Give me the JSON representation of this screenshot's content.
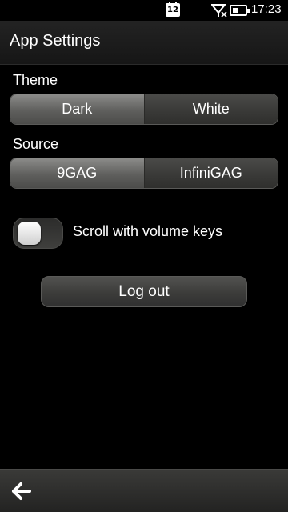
{
  "status_bar": {
    "calendar_day": "12",
    "time": "17:23",
    "icons": [
      "calendar-icon",
      "no-network-icon",
      "battery-icon"
    ]
  },
  "header": {
    "title": "App Settings"
  },
  "theme": {
    "label": "Theme",
    "options": [
      "Dark",
      "White"
    ],
    "selected": "Dark"
  },
  "source": {
    "label": "Source",
    "options": [
      "9GAG",
      "InfiniGAG"
    ],
    "selected": "9GAG"
  },
  "scroll_toggle": {
    "label": "Scroll with volume keys",
    "state": "off"
  },
  "logout": {
    "label": "Log out"
  },
  "toolbar": {
    "back_icon": "back-arrow-icon"
  }
}
